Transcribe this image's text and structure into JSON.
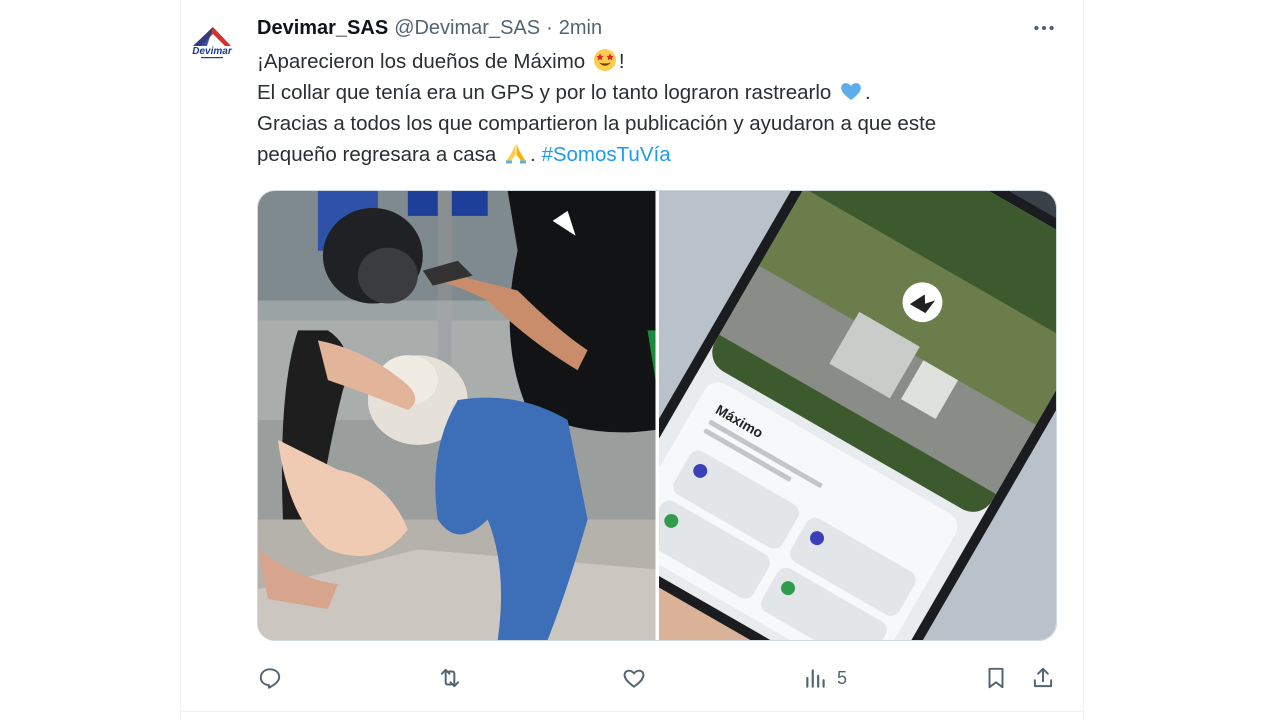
{
  "tweet": {
    "display_name": "Devimar_SAS",
    "handle": "@Devimar_SAS",
    "separator": "·",
    "timestamp": "2min",
    "line1_text": "¡Aparecieron los dueños de Máximo",
    "line1_end": "!",
    "line2_text": "El collar que tenía era un GPS y por lo tanto lograron rastrearlo",
    "line2_end": ".",
    "line3_text": "Gracias a todos los que compartieron la publicación y ayudaron a que este",
    "line4_text": "pequeño regresara a casa",
    "line4_sep": ". ",
    "hashtag": "#SomosTuVía"
  },
  "avatar": {
    "logo_text": "Devimar"
  },
  "photos": {
    "phone_app_title": "Máximo"
  },
  "actions": {
    "views_count": "5"
  },
  "icons": {
    "more": "more-horizontal-icon",
    "emoji1": "star-struck-emoji",
    "emoji2": "blue-heart-emoji",
    "emoji3": "folded-hands-emoji",
    "reply": "reply-icon",
    "retweet": "retweet-icon",
    "like": "like-icon",
    "views": "views-icon",
    "bookmark": "bookmark-icon",
    "share": "share-icon"
  },
  "colors": {
    "accent": "#1d9bf0",
    "secondary_text": "#536471",
    "brand_red": "#d0342c",
    "brand_blue": "#1a3d8f"
  }
}
